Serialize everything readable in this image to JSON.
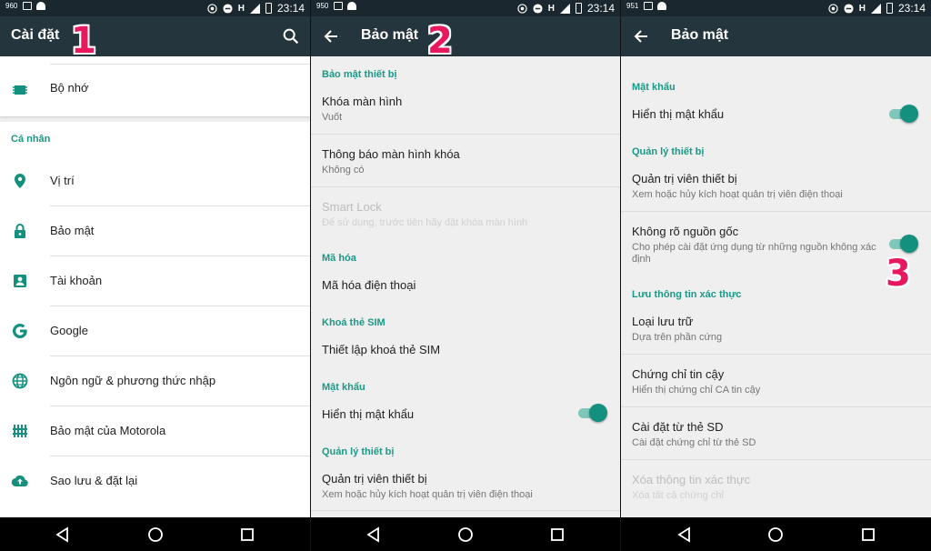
{
  "status": {
    "p1_num": "960",
    "p2_num": "950",
    "p3_num": "951",
    "time": "23:14",
    "net": "H"
  },
  "panel1": {
    "title": "Cài đặt",
    "badge": "1",
    "storage": "Bộ nhớ",
    "section_personal": "Cá nhân",
    "items": [
      {
        "label": "Vị trí",
        "icon": "location-icon"
      },
      {
        "label": "Bảo mật",
        "icon": "lock-icon"
      },
      {
        "label": "Tài khoản",
        "icon": "account-icon"
      },
      {
        "label": "Google",
        "icon": "google-icon"
      },
      {
        "label": "Ngôn ngữ & phương thức nhập",
        "icon": "globe-icon"
      },
      {
        "label": "Bảo mật của Motorola",
        "icon": "motorola-icon"
      },
      {
        "label": "Sao lưu & đặt lại",
        "icon": "cloud-upload-icon"
      }
    ]
  },
  "panel2": {
    "title": "Bảo mật",
    "badge": "2",
    "sec_device": "Bảo mật thiết bị",
    "screen_lock": {
      "title": "Khóa màn hình",
      "sub": "Vuốt"
    },
    "lock_notif": {
      "title": "Thông báo màn hình khóa",
      "sub": "Không có"
    },
    "smart_lock": {
      "title": "Smart Lock",
      "sub": "Để sử dụng, trước tiên hãy đặt khóa màn hình"
    },
    "sec_encrypt": "Mã hóa",
    "encrypt_phone": "Mã hóa điện thoại",
    "sec_sim": "Khoá thẻ SIM",
    "sim_setup": "Thiết lập khoá thẻ SIM",
    "sec_password": "Mật khẩu",
    "show_password": "Hiển thị mật khẩu",
    "sec_device_admin": "Quản lý thiết bị",
    "device_admin": {
      "title": "Quản trị viên thiết bị",
      "sub": "Xem hoặc hủy kích hoạt quản trị viên điện thoại"
    }
  },
  "panel3": {
    "title": "Bảo mật",
    "badge": "3",
    "sec_password": "Mật khẩu",
    "show_password": "Hiển thị mật khẩu",
    "sec_device_admin": "Quản lý thiết bị",
    "device_admin": {
      "title": "Quản trị viên thiết bị",
      "sub": "Xem hoặc hủy kích hoạt quản trị viên điện thoại"
    },
    "unknown_sources": {
      "title": "Không rõ nguồn gốc",
      "sub": "Cho phép cài đặt ứng dụng từ những nguồn không xác định"
    },
    "sec_credentials": "Lưu thông tin xác thực",
    "storage_type": {
      "title": "Loại lưu trữ",
      "sub": "Dựa trên phần cứng"
    },
    "trusted_creds": {
      "title": "Chứng chỉ tin cậy",
      "sub": "Hiển thị chứng chỉ CA tin cậy"
    },
    "install_sd": {
      "title": "Cài đặt từ thẻ SD",
      "sub": "Cài đặt chứng chỉ từ thẻ SD"
    },
    "clear_creds": {
      "title": "Xóa thông tin xác thực",
      "sub": "Xóa tất cả chứng chỉ"
    }
  },
  "colors": {
    "accent": "#1a9986",
    "appbar": "#25353d",
    "badge": "#e8185f"
  }
}
